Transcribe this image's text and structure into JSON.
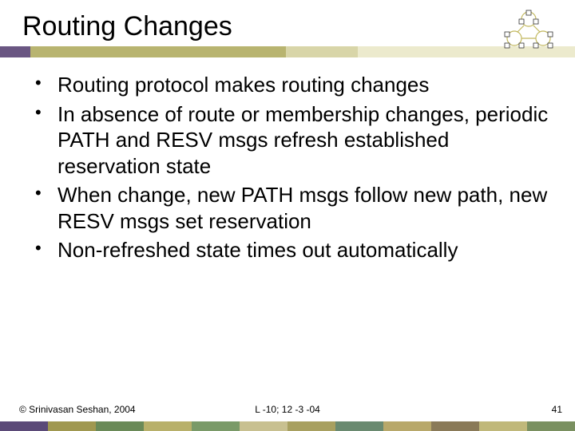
{
  "title": "Routing Changes",
  "bullets": [
    "Routing protocol makes routing changes",
    "In absence of route or membership changes, periodic PATH and RESV msgs refresh established reservation state",
    "When change, new PATH msgs follow new path, new RESV msgs set reservation",
    "Non-refreshed state times out automatically"
  ],
  "footer": {
    "left": "© Srinivasan Seshan, 2004",
    "mid": "L -10; 12 -3 -04",
    "right": "41"
  }
}
